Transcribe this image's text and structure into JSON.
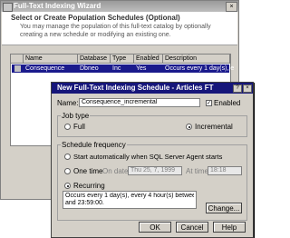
{
  "wizard": {
    "title": "Full-Text Indexing Wizard",
    "close_label": "×",
    "header_title": "Select or Create Population Schedules (Optional)",
    "header_line1": "You may manage the population of this full-text catalog by optionally",
    "header_line2": "creating a new schedule or modifying an existing one.",
    "columns": [
      "Name",
      "Database",
      "Type",
      "Enabled",
      "Description"
    ],
    "row": {
      "name": "Consequence",
      "database": "Dbneo",
      "type": "Inc",
      "enabled": "Yes",
      "description": "Occurs every 1 day(s), e"
    }
  },
  "dialog": {
    "title": "New Full-Text Indexing Schedule - Articles FT",
    "help_label": "?",
    "close_label": "×",
    "name_label": "Name:",
    "name_value": "Consequence_incremental",
    "enabled_label": "Enabled",
    "job_type_title": "Job type",
    "full_label": "Full",
    "incremental_label": "Incremental",
    "schedule_title": "Schedule frequency",
    "start_auto_label": "Start automatically when SQL Server Agent starts",
    "one_time_label": "One time",
    "on_date_label": "On date:",
    "on_date_value": "Thu 25, 7, 1999",
    "at_time_label": "At time:",
    "at_time_value": "18:18",
    "recurring_label": "Recurring",
    "recurring_desc_line1": "Occurs every 1 day(s), every 4 hour(s) between 0:00:00",
    "recurring_desc_line2": "and 23:59:00.",
    "change_label": "Change...",
    "ok_label": "OK",
    "cancel_label": "Cancel",
    "help_button_label": "Help"
  }
}
